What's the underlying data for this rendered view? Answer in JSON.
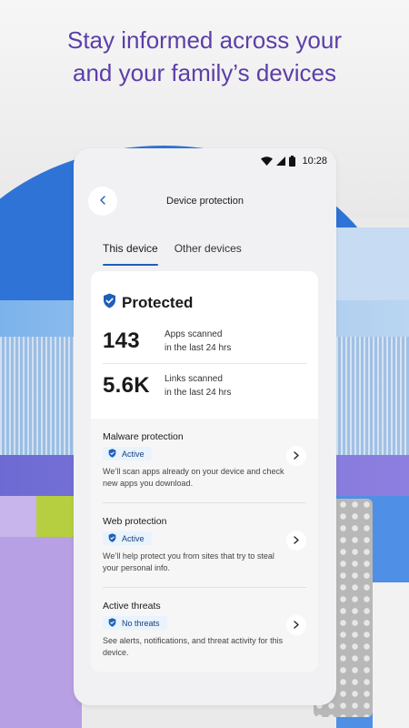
{
  "headline": {
    "line1": "Stay informed across your",
    "line2": "and your family’s devices"
  },
  "status_bar": {
    "time": "10:28",
    "icons": [
      "wifi-icon",
      "signal-icon",
      "battery-icon"
    ]
  },
  "nav": {
    "back_icon": "chevron-left-icon",
    "title": "Device protection"
  },
  "tabs": [
    {
      "label": "This device",
      "active": true
    },
    {
      "label": "Other devices",
      "active": false
    }
  ],
  "summary": {
    "status_icon": "shield-check-icon",
    "status": "Protected",
    "stats": [
      {
        "value": "143",
        "line1": "Apps scanned",
        "line2": "in the last 24 hrs"
      },
      {
        "value": "5.6K",
        "line1": "Links scanned",
        "line2": "in the last 24 hrs"
      }
    ]
  },
  "features": [
    {
      "title": "Malware protection",
      "badge": "Active",
      "description": "We’ll scan apps already on your device and check new apps you download."
    },
    {
      "title": "Web protection",
      "badge": "Active",
      "description": "We’ll help protect you from sites that try to steal your personal info."
    },
    {
      "title": "Active threats",
      "badge": "No threats",
      "description": "See alerts, notifications, and threat activity for this device."
    }
  ],
  "colors": {
    "headline": "#5b3fa8",
    "accent": "#1f5fb8",
    "shield": "#1f5fb8",
    "badge_bg": "#e8f3fd"
  }
}
